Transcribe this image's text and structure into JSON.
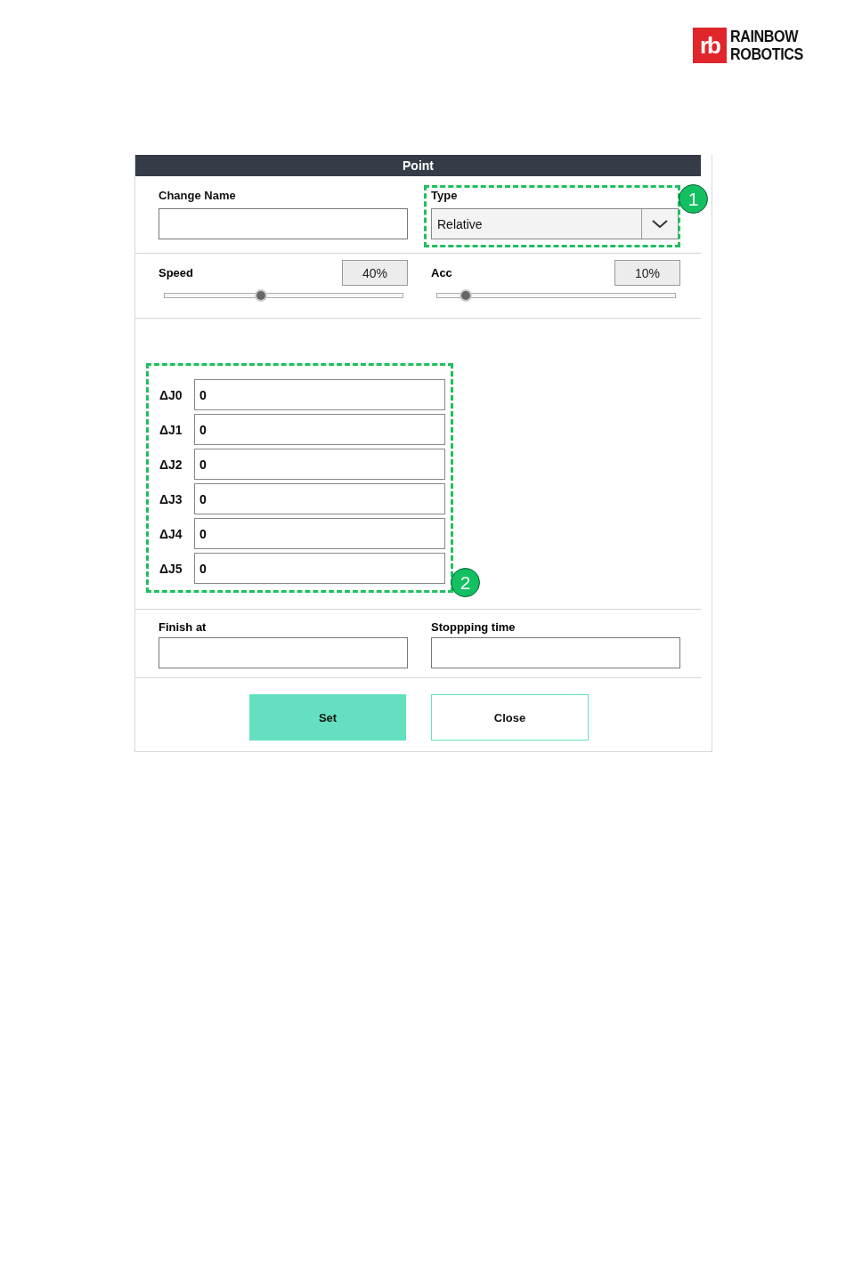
{
  "logo": {
    "mark": "rb",
    "line_1": "RAINBOW",
    "line_2": "ROBOTICS"
  },
  "dialog": {
    "title": "Point",
    "change_name": {
      "label": "Change Name"
    },
    "type": {
      "label": "Type",
      "value": "Relative"
    },
    "speed": {
      "label": "Speed",
      "reading": "40%",
      "level": 0.4
    },
    "acc": {
      "label": "Acc",
      "reading": "10%",
      "level": 0.1
    },
    "joints": [
      {
        "label": "ΔJ0",
        "value": "0"
      },
      {
        "label": "ΔJ1",
        "value": "0"
      },
      {
        "label": "ΔJ2",
        "value": "0"
      },
      {
        "label": "ΔJ3",
        "value": "0"
      },
      {
        "label": "ΔJ4",
        "value": "0"
      },
      {
        "label": "ΔJ5",
        "value": "0"
      }
    ],
    "finish_at": {
      "label": "Finish at"
    },
    "stopping_time": {
      "label": "Stoppping time"
    },
    "buttons": [
      {
        "label": "Set",
        "kind": "primary"
      },
      {
        "label": "Close",
        "kind": "secondary"
      }
    ]
  },
  "callouts": [
    {
      "label": "1"
    },
    {
      "label": "2"
    }
  ]
}
